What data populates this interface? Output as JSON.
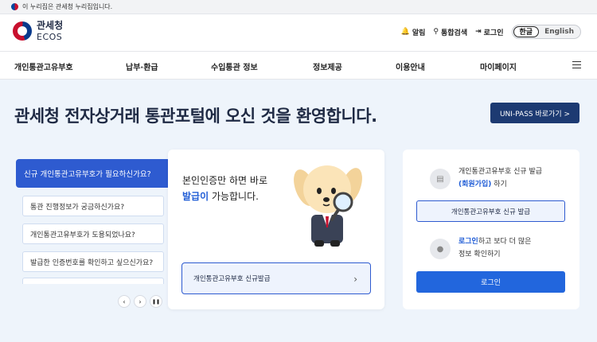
{
  "gov_bar": {
    "text": "이 누리집은 관세청 누리집입니다."
  },
  "header": {
    "logo_kr": "관세청",
    "logo_en": "ECOS",
    "utils": [
      {
        "label": "알림",
        "icon": "bell-icon"
      },
      {
        "label": "통합검색",
        "icon": "search-icon"
      },
      {
        "label": "로그인",
        "icon": "login-icon"
      }
    ],
    "lang_active": "한글",
    "lang_inactive": "English"
  },
  "nav": {
    "items": [
      "개인통관고유부호",
      "납부·환급",
      "수입통관 정보",
      "정보제공",
      "이용안내",
      "마이페이지"
    ]
  },
  "hero": {
    "title": "관세청 전자상거래 통관포털에 오신 것을 환영합니다.",
    "unipass_button": "UNI-PASS 바로가기 >"
  },
  "faq": {
    "active": "신규 개인통관고유부호가 필요하신가요?",
    "items": [
      "통관 진행정보가 궁금하신가요?",
      "개인통관고유부호가 도용되었나요?",
      "발급한 인증번호를 확인하고 싶으신가요?"
    ],
    "controls": [
      "‹",
      "›",
      "❚❚"
    ]
  },
  "issue_card": {
    "line1": "본인인증만 하면 바로",
    "line2_highlight": "발급이",
    "line2_rest": " 가능합니다.",
    "button": "개인통관고유부호 신규발급",
    "chevron": "›"
  },
  "side_card": {
    "issue_text_a": "개인통관고유부호 신규 발급",
    "issue_text_b_link": "(회원가입)",
    "issue_text_b_rest": " 하기",
    "issue_button": "개인통관고유부호 신규 발급",
    "login_text_a_link": "로그인",
    "login_text_a_rest": "하고 보다 더 많은",
    "login_text_b": "정보 확인하기",
    "login_button": "로그인"
  },
  "colors": {
    "primary": "#2e5bd0",
    "navy": "#1d3a72",
    "accent_red": "#d6262e",
    "bg": "#eef4fb"
  }
}
